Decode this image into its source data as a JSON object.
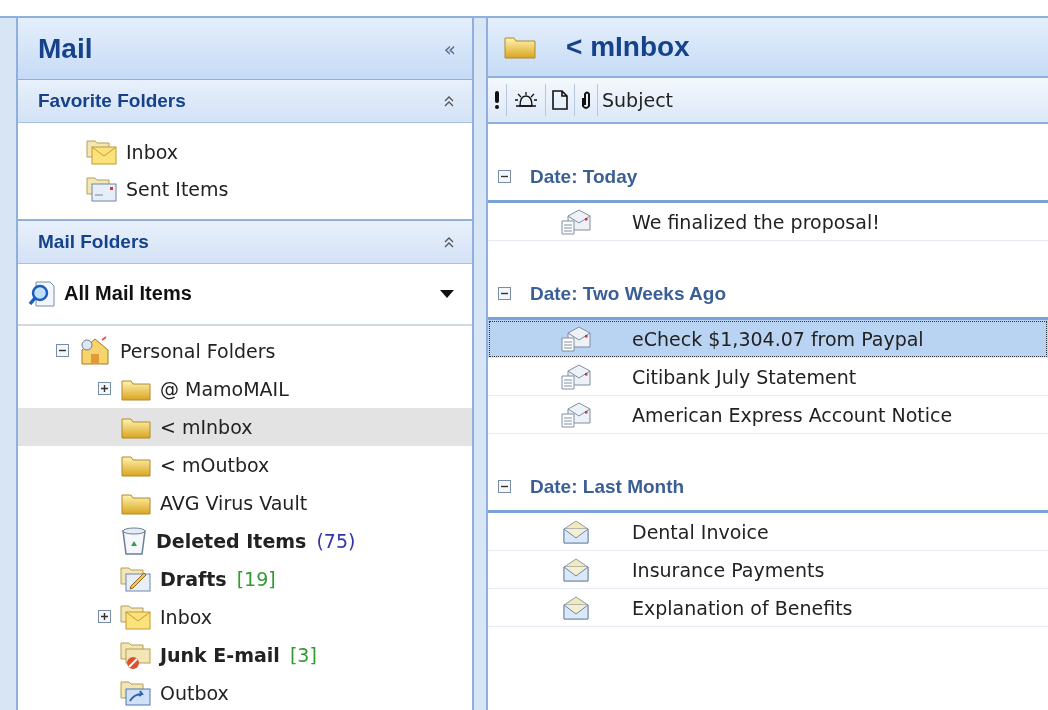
{
  "navigation_pane": {
    "title": "Mail",
    "collapse_glyph": "«",
    "favorite_folders": {
      "title": "Favorite Folders",
      "expanded": true,
      "items": [
        {
          "label": "Inbox",
          "kind": "inbox"
        },
        {
          "label": "Sent Items",
          "kind": "sent"
        }
      ]
    },
    "mail_folders": {
      "title": "Mail Folders",
      "expanded": true,
      "view_selector": "All Mail Items",
      "tree": [
        {
          "label": "Personal Folders",
          "kind": "personal",
          "expanded": true,
          "bold": false,
          "selected": false,
          "children": [
            {
              "label": "@ MamoMAIL",
              "kind": "folder",
              "expanded": false,
              "bold": false,
              "selected": false
            },
            {
              "label": "< mInbox",
              "kind": "folder",
              "bold": false,
              "selected": true
            },
            {
              "label": "< mOutbox",
              "kind": "folder",
              "bold": false,
              "selected": false
            },
            {
              "label": "AVG Virus Vault",
              "kind": "folder",
              "bold": false,
              "selected": false
            },
            {
              "label": "Deleted Items",
              "kind": "deleted",
              "bold": true,
              "selected": false,
              "count": "(75)",
              "color": "#3333aa"
            },
            {
              "label": "Drafts",
              "kind": "drafts",
              "bold": true,
              "selected": false,
              "count": "[19]",
              "color": "#339933"
            },
            {
              "label": "Inbox",
              "kind": "inbox",
              "expanded": false,
              "bold": false,
              "selected": false
            },
            {
              "label": "Junk E-mail",
              "kind": "junk",
              "bold": true,
              "selected": false,
              "count": "[3]",
              "color": "#339933"
            },
            {
              "label": "Outbox",
              "kind": "outbox",
              "bold": false,
              "selected": false
            }
          ]
        }
      ]
    }
  },
  "message_list": {
    "folder_title": "< mInbox",
    "columns": [
      {
        "kind": "importance"
      },
      {
        "kind": "reminder"
      },
      {
        "kind": "icon"
      },
      {
        "kind": "attachment"
      },
      {
        "kind": "text",
        "label": "Subject"
      }
    ],
    "groups": [
      {
        "title": "Date: Today",
        "expanded": true,
        "messages": [
          {
            "subject": "We finalized the proposal!",
            "kind": "document",
            "selected": false
          }
        ]
      },
      {
        "title": "Date: Two Weeks Ago",
        "expanded": true,
        "messages": [
          {
            "subject": "eCheck $1,304.07 from Paypal",
            "kind": "document",
            "selected": true
          },
          {
            "subject": "Citibank July Statement",
            "kind": "document",
            "selected": false
          },
          {
            "subject": "American Express Account Notice",
            "kind": "document",
            "selected": false
          }
        ]
      },
      {
        "title": "Date: Last Month",
        "expanded": true,
        "messages": [
          {
            "subject": "Dental Invoice",
            "kind": "envelope",
            "selected": false
          },
          {
            "subject": "Insurance Payments",
            "kind": "envelope",
            "selected": false
          },
          {
            "subject": "Explanation of Benefits",
            "kind": "envelope",
            "selected": false
          }
        ]
      }
    ]
  }
}
